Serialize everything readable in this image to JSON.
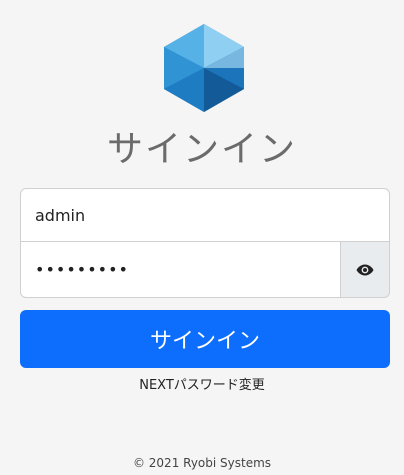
{
  "logo": {
    "icon": "hexagon-cube-logo"
  },
  "title": "サインイン",
  "username": {
    "value": "admin",
    "placeholder": ""
  },
  "password": {
    "value": "•••••••••",
    "placeholder": ""
  },
  "password_toggle": {
    "icon": "eye-icon"
  },
  "signin_button": {
    "label": "サインイン"
  },
  "change_password_link": {
    "label": "NEXTパスワード変更"
  },
  "footer": {
    "copyright": "© 2021 Ryobi Systems"
  },
  "colors": {
    "background": "#f5f5f5",
    "primary": "#0d6efd",
    "title": "#6b6b6b",
    "logo_dark": "#1a6fb5",
    "logo_light": "#7cc7ef"
  }
}
